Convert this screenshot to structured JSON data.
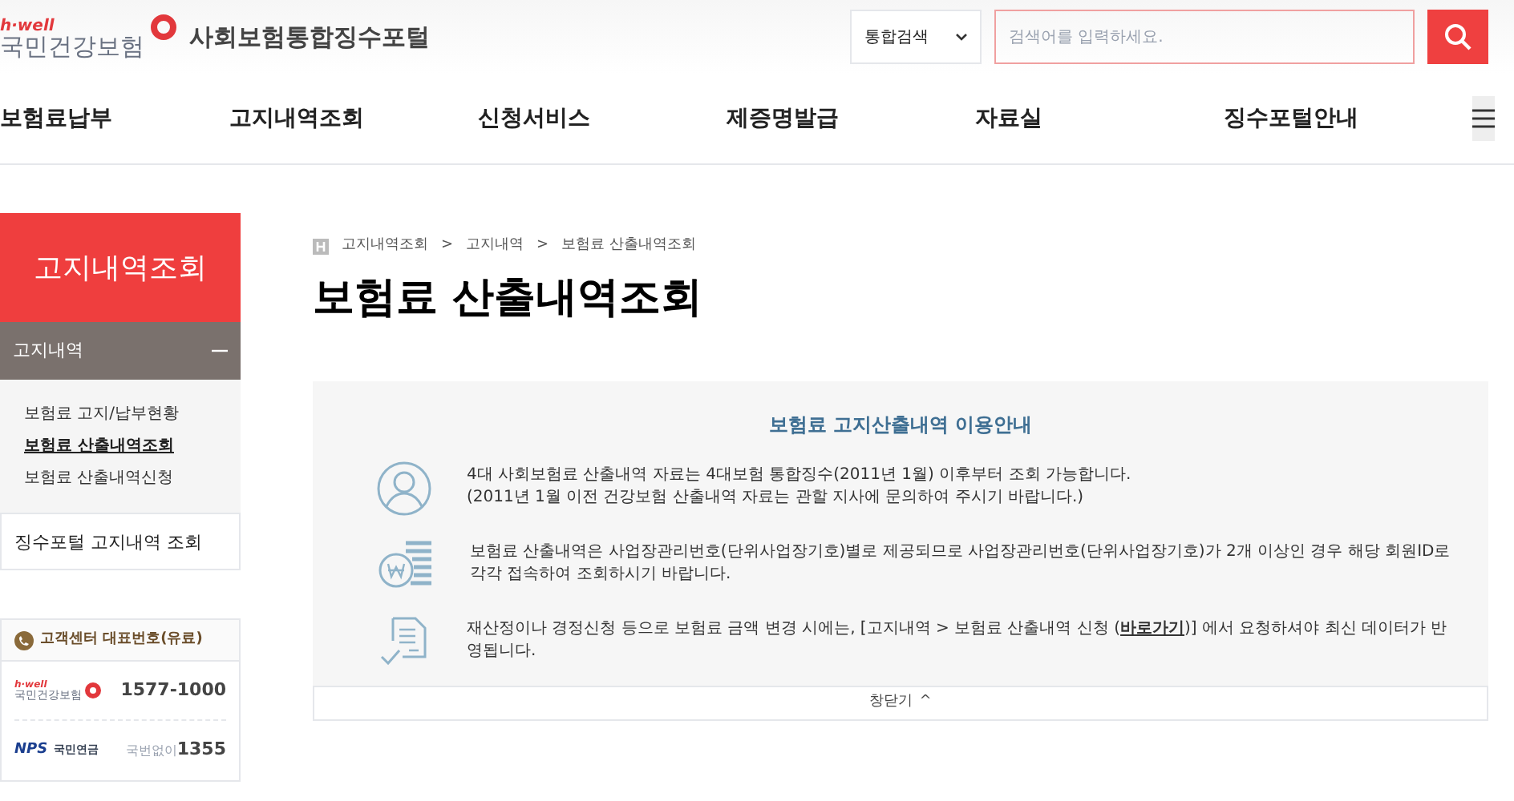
{
  "header": {
    "logo_tag": "h·well",
    "logo_name": "국민건강보험",
    "portal_title": "사회보험통합징수포털",
    "search_scope": "통합검색",
    "search_placeholder": "검색어를 입력하세요."
  },
  "nav": [
    {
      "label": "보험료납부"
    },
    {
      "label": "고지내역조회"
    },
    {
      "label": "신청서비스"
    },
    {
      "label": "제증명발급"
    },
    {
      "label": "자료실"
    },
    {
      "label": "징수포털안내"
    }
  ],
  "sidebar": {
    "title": "고지내역조회",
    "group": {
      "label": "고지내역",
      "expanded": true,
      "items": [
        {
          "label": "보험료 고지/납부현황",
          "selected": false
        },
        {
          "label": "보험료 산출내역조회",
          "selected": true
        },
        {
          "label": "보험료 산출내역신청",
          "selected": false
        }
      ]
    },
    "other": "징수포털 고지내역 조회"
  },
  "contact": {
    "title": "고객센터 대표번호(유료)",
    "rows": [
      {
        "kind": "nhis",
        "logo_tag": "h·well",
        "logo_name": "국민건강보험",
        "prefix": "",
        "number": "1577-1000"
      },
      {
        "kind": "nps",
        "logo_tag": "NPS",
        "logo_name": "국민연금",
        "prefix": "국번없이",
        "number": "1355"
      }
    ]
  },
  "breadcrumb": [
    "고지내역조회",
    "고지내역",
    "보험료 산출내역조회"
  ],
  "breadcrumb_separator": ">",
  "page_title": "보험료 산출내역조회",
  "notice": {
    "title": "보험료 고지산출내역 이용안내",
    "items": [
      {
        "kind": "person",
        "lines": [
          "4대 사회보험료 산출내역 자료는 4대보험 통합징수(2011년 1월) 이후부터 조회 가능합니다.",
          "(2011년 1월 이전 건강보험 산출내역 자료는 관할 지사에 문의하여 주시기 바랍니다.)"
        ]
      },
      {
        "kind": "money",
        "lines": [
          "보험료 산출내역은 사업장관리번호(단위사업장기호)별로 제공되므로 사업장관리번호(단위사업장기호)가 2개 이상인 경우 해당 회원ID로 각각 접속하여 조회하시기 바랍니다."
        ]
      },
      {
        "kind": "document",
        "before": "재산정이나 경정신청 등으로 보험료 금액 변경 시에는, [고지내역 > 보험료 산출내역 신청 (",
        "link": "바로가기",
        "after": ")] 에서 요청하셔야 최신 데이터가 반영됩니다."
      }
    ],
    "close_label": "창닫기",
    "close_arrow": "^"
  }
}
